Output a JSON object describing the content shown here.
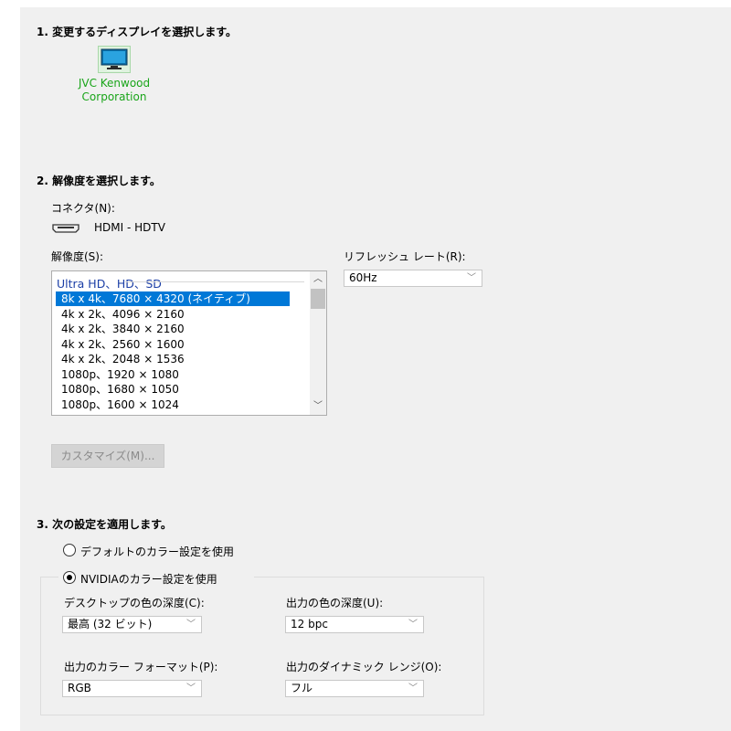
{
  "section1": {
    "heading": "1. 変更するディスプレイを選択します。",
    "display_name_line1": "JVC Kenwood",
    "display_name_line2": "Corporation"
  },
  "section2": {
    "heading": "2. 解像度を選択します。",
    "connector_label": "コネクタ(N):",
    "connector_value": "HDMI - HDTV",
    "resolution_label": "解像度(S):",
    "refresh_label": "リフレッシュ レート(R):",
    "refresh_value": "60Hz",
    "list_group": "Ultra HD、HD、SD",
    "resolutions": [
      "8k x 4k、7680 × 4320 (ネイティブ)",
      "4k x 2k、4096 × 2160",
      "4k x 2k、3840 × 2160",
      "4k x 2k、2560 × 1600",
      "4k x 2k、2048 × 1536",
      "1080p、1920 × 1080",
      "1080p、1680 × 1050",
      "1080p、1600 × 1024"
    ],
    "customize_button": "カスタマイズ(M)..."
  },
  "section3": {
    "heading": "3. 次の設定を適用します。",
    "radio_default": "デフォルトのカラー設定を使用",
    "radio_nvidia": "NVIDIAのカラー設定を使用",
    "desktop_depth_label": "デスクトップの色の深度(C):",
    "desktop_depth_value": "最高 (32 ビット)",
    "output_depth_label": "出力の色の深度(U):",
    "output_depth_value": "12 bpc",
    "color_format_label": "出力のカラー フォーマット(P):",
    "color_format_value": "RGB",
    "dynamic_range_label": "出力のダイナミック レンジ(O):",
    "dynamic_range_value": "フル"
  },
  "colors": {
    "panel_bg": "#f0f0f0",
    "selection": "#0078d7",
    "display_name": "#1aa51a",
    "list_group": "#1c3fa6"
  },
  "icons": [
    "monitor-icon",
    "hdmi-icon",
    "chevron-down-icon",
    "chevron-up-icon"
  ]
}
